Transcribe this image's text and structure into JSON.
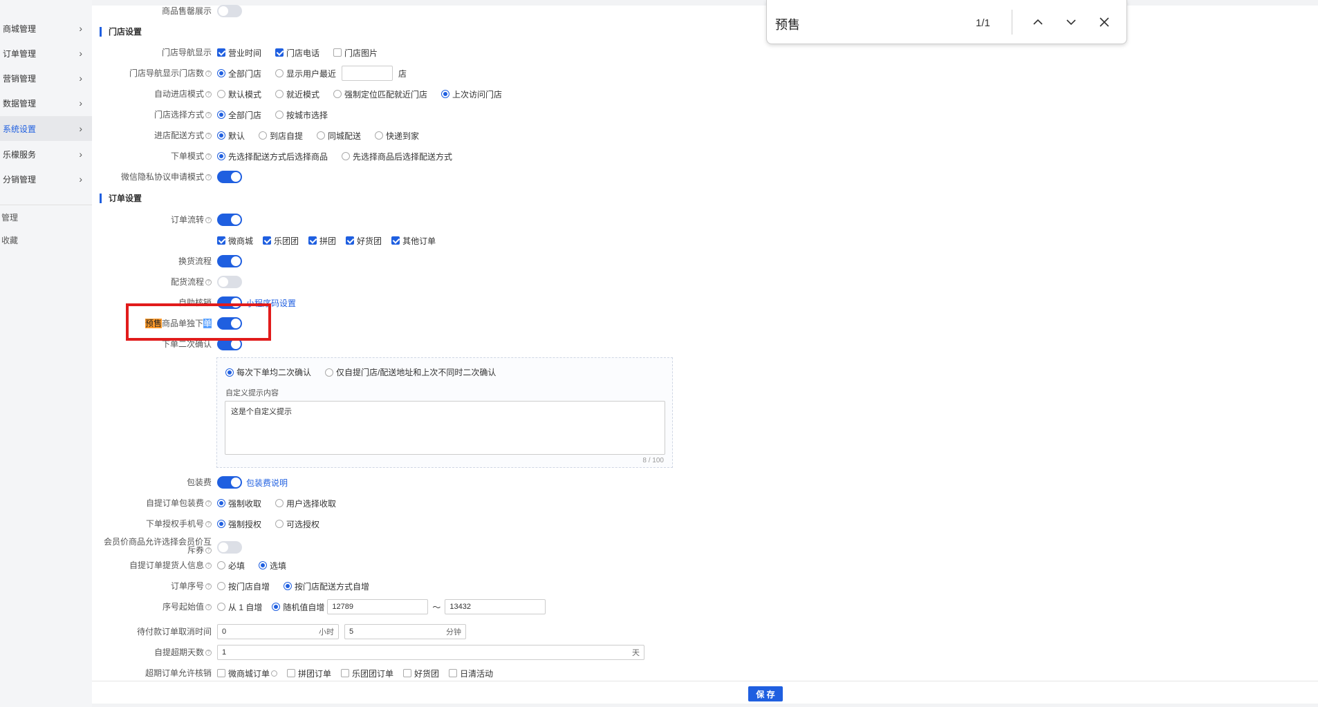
{
  "sidebar": {
    "items": [
      {
        "label": "商城管理"
      },
      {
        "label": "订单管理"
      },
      {
        "label": "营销管理"
      },
      {
        "label": "数据管理"
      },
      {
        "label": "系统设置"
      },
      {
        "label": "乐檬服务"
      },
      {
        "label": "分销管理"
      }
    ],
    "extra": [
      "管理",
      "收藏"
    ]
  },
  "find": {
    "query": "预售",
    "count": "1/1"
  },
  "top_row": {
    "label": "商品售罄展示"
  },
  "store_section": {
    "title": "门店设置",
    "nav_display": {
      "label": "门店导航显示",
      "options": [
        "营业时间",
        "门店电话",
        "门店图片"
      ]
    },
    "nav_count": {
      "label": "门店导航显示门店数",
      "options": [
        "全部门店",
        "显示用户最近"
      ],
      "suffix": "店"
    },
    "auto_enter": {
      "label": "自动进店模式",
      "options": [
        "默认模式",
        "就近模式",
        "强制定位匹配就近门店",
        "上次访问门店"
      ]
    },
    "select_mode": {
      "label": "门店选择方式",
      "options": [
        "全部门店",
        "按城市选择"
      ]
    },
    "delivery": {
      "label": "进店配送方式",
      "options": [
        "默认",
        "到店自提",
        "同城配送",
        "快递到家"
      ]
    },
    "order_mode": {
      "label": "下单模式",
      "options": [
        "先选择配送方式后选择商品",
        "先选择商品后选择配送方式"
      ]
    },
    "privacy": {
      "label": "微信隐私协议申请模式"
    }
  },
  "order_section": {
    "title": "订单设置",
    "flow": {
      "label": "订单流转",
      "options": [
        "微商城",
        "乐团团",
        "拼团",
        "好货团",
        "其他订单"
      ]
    },
    "exchange": {
      "label": "换货流程"
    },
    "distribution": {
      "label": "配货流程"
    },
    "self_pickup": {
      "label": "自助核销",
      "link": "小程序码设置"
    },
    "presale": {
      "label_hl": "预售",
      "label_mid": "商品单独下",
      "label_tail": "单"
    },
    "confirm": {
      "label": "下单二次确认",
      "options": [
        "每次下单均二次确认",
        "仅自提门店/配送地址和上次不同时二次确认"
      ],
      "custom_label": "自定义提示内容",
      "custom_text": "这是个自定义提示",
      "counter": "8 / 100"
    },
    "packing": {
      "label": "包装费",
      "link": "包装费说明"
    },
    "pickup_packing": {
      "label": "自提订单包装费",
      "options": [
        "强制收取",
        "用户选择收取"
      ]
    },
    "phone_auth": {
      "label": "下单授权手机号",
      "options": [
        "强制授权",
        "可选授权"
      ]
    },
    "member_price": {
      "label_1": "会员价商品允许选择会员价互",
      "label_2": "斥券"
    },
    "pickup_info": {
      "label": "自提订单提货人信息",
      "options": [
        "必填",
        "选填"
      ]
    },
    "seq": {
      "label": "订单序号",
      "options": [
        "按门店自增",
        "按门店配送方式自增"
      ]
    },
    "seq_start": {
      "label": "序号起始值",
      "options": [
        "从 1 自增",
        "随机值自增"
      ],
      "from": "12789",
      "tilde": "〜",
      "to": "13432"
    },
    "cancel_time": {
      "label": "待付款订单取消时间",
      "hours": "0",
      "hours_unit": "小时",
      "minutes": "5",
      "minutes_unit": "分钟"
    },
    "pickup_days": {
      "label": "自提超期天数",
      "value": "1",
      "unit": "天"
    },
    "overdue": {
      "label": "超期订单允许核销",
      "options": [
        "微商城订单",
        "拼团订单",
        "乐团团订单",
        "好货团",
        "日清活动"
      ]
    }
  },
  "save_label": "保 存",
  "colors": {
    "accent": "#1f5fe0",
    "highlight": "#e11b1b"
  }
}
